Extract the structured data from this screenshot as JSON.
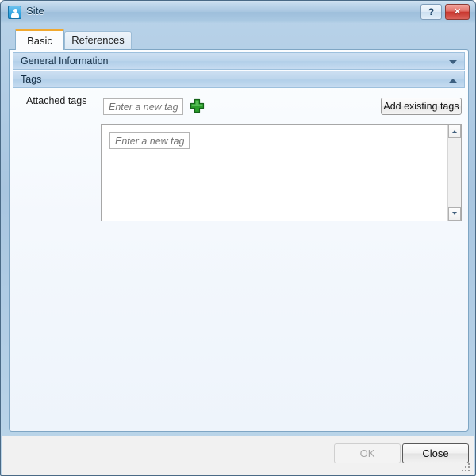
{
  "window": {
    "title": "Site",
    "icon": "user-site-icon",
    "controls": {
      "help_label": "?",
      "close_label": "✕"
    }
  },
  "tabs": [
    {
      "label": "Basic",
      "active": true
    },
    {
      "label": "References",
      "active": false
    }
  ],
  "sections": [
    {
      "label": "General Information",
      "expanded": false,
      "arrow": "chevron-down"
    },
    {
      "label": "Tags",
      "expanded": true,
      "arrow": "chevron-up"
    }
  ],
  "tags_panel": {
    "attached_label": "Attached tags",
    "new_tag_placeholder": "Enter a new tag",
    "new_tag_value": "",
    "add_tag_icon": "green-plus-icon",
    "add_existing_label": "Add existing tags",
    "listbox": {
      "items": [],
      "inner_new_tag_placeholder": "Enter a new tag",
      "inner_new_tag_value": "",
      "scrollbar": {
        "up_arrow": "scroll-up-arrow",
        "down_arrow": "scroll-down-arrow"
      }
    }
  },
  "footer": {
    "ok_label": "OK",
    "ok_enabled": false,
    "close_label": "Close",
    "close_enabled": true
  },
  "colors": {
    "accent_tab": "#f0a830",
    "title_bar": "#a8c6e0",
    "close_button": "#c8352c",
    "section_header": "#bcd5ec",
    "plus_icon": "#1f8a1f",
    "placeholder_text": "#6a6aa8"
  }
}
